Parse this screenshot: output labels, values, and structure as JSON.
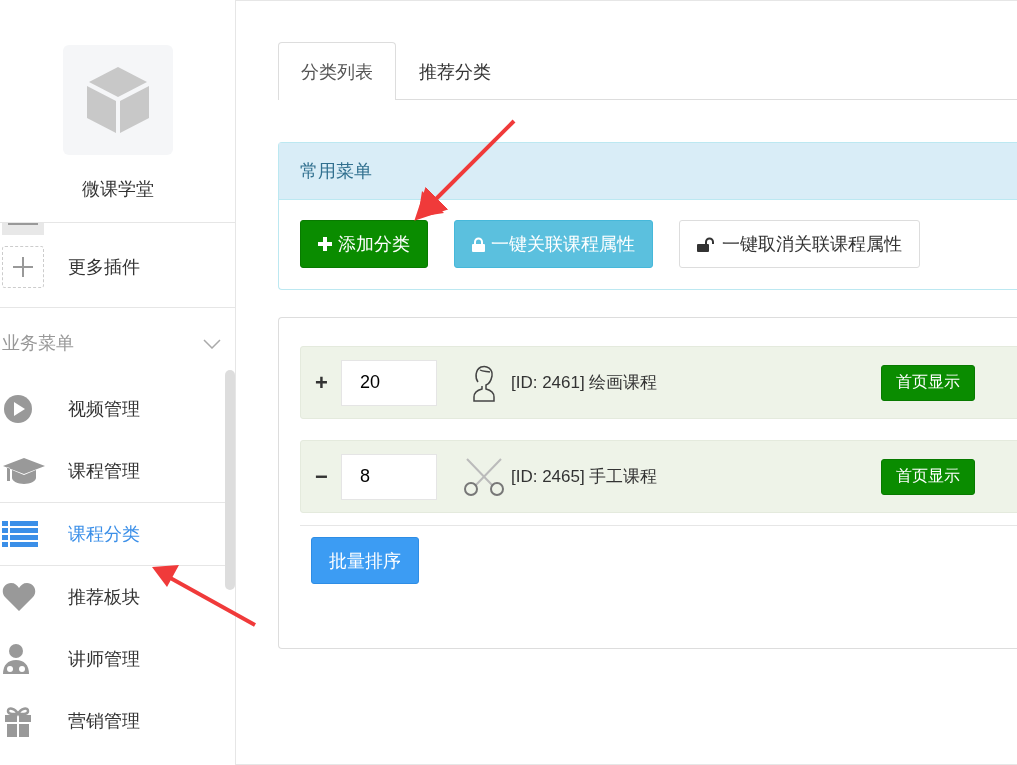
{
  "sidebar": {
    "app_name": "微课学堂",
    "plugins": [
      {
        "label": "更多插件"
      }
    ],
    "menu_group": {
      "title": "业务菜单",
      "expanded": true
    },
    "items": [
      {
        "label": "视频管理",
        "selected": false
      },
      {
        "label": "课程管理",
        "selected": false
      },
      {
        "label": "课程分类",
        "selected": true
      },
      {
        "label": "推荐板块",
        "selected": false
      },
      {
        "label": "讲师管理",
        "selected": false
      },
      {
        "label": "营销管理",
        "selected": false
      }
    ]
  },
  "tabs": [
    {
      "label": "分类列表",
      "selected": true
    },
    {
      "label": "推荐分类",
      "selected": false
    }
  ],
  "menu_panel": {
    "title": "常用菜单",
    "buttons": [
      {
        "label": "添加分类",
        "kind": "add"
      },
      {
        "label": "一键关联课程属性",
        "kind": "lock"
      },
      {
        "label": "一键取消关联课程属性",
        "kind": "unlock"
      }
    ]
  },
  "categories": [
    {
      "toggle": "+",
      "sort": "20",
      "title": "[ID: 2461] 绘画课程",
      "action": "首页显示"
    },
    {
      "toggle": "−",
      "sort": "8",
      "title": "[ID: 2465] 手工课程",
      "action": "首页显示"
    }
  ],
  "batch_button": "批量排序"
}
